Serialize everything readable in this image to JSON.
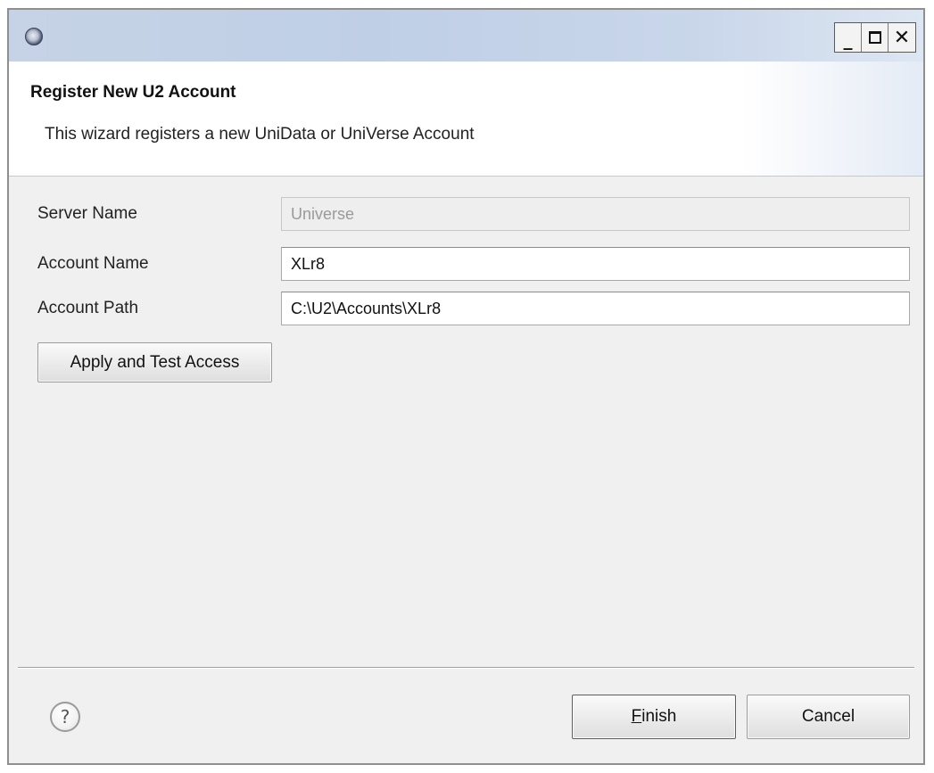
{
  "window": {
    "controls": {
      "minimize": "_",
      "maximize": "",
      "close": "✕"
    }
  },
  "header": {
    "title": "Register New U2 Account",
    "description": "This wizard registers a new UniData or UniVerse Account"
  },
  "form": {
    "server_name": {
      "label": "Server Name",
      "value": "Universe",
      "disabled": true
    },
    "account_name": {
      "label": "Account Name",
      "value": "XLr8"
    },
    "account_path": {
      "label": "Account Path",
      "value": "C:\\U2\\Accounts\\XLr8"
    },
    "apply_button_label": "Apply and Test Access"
  },
  "footer": {
    "help_icon": "question-mark-icon",
    "help_glyph": "?",
    "finish_mnemonic": "F",
    "finish_rest": "inish",
    "cancel_label": "Cancel"
  },
  "colors": {
    "titlebar": "#c6d3e6",
    "dialog_background": "#f0f0f0",
    "header_background": "#ffffff"
  }
}
